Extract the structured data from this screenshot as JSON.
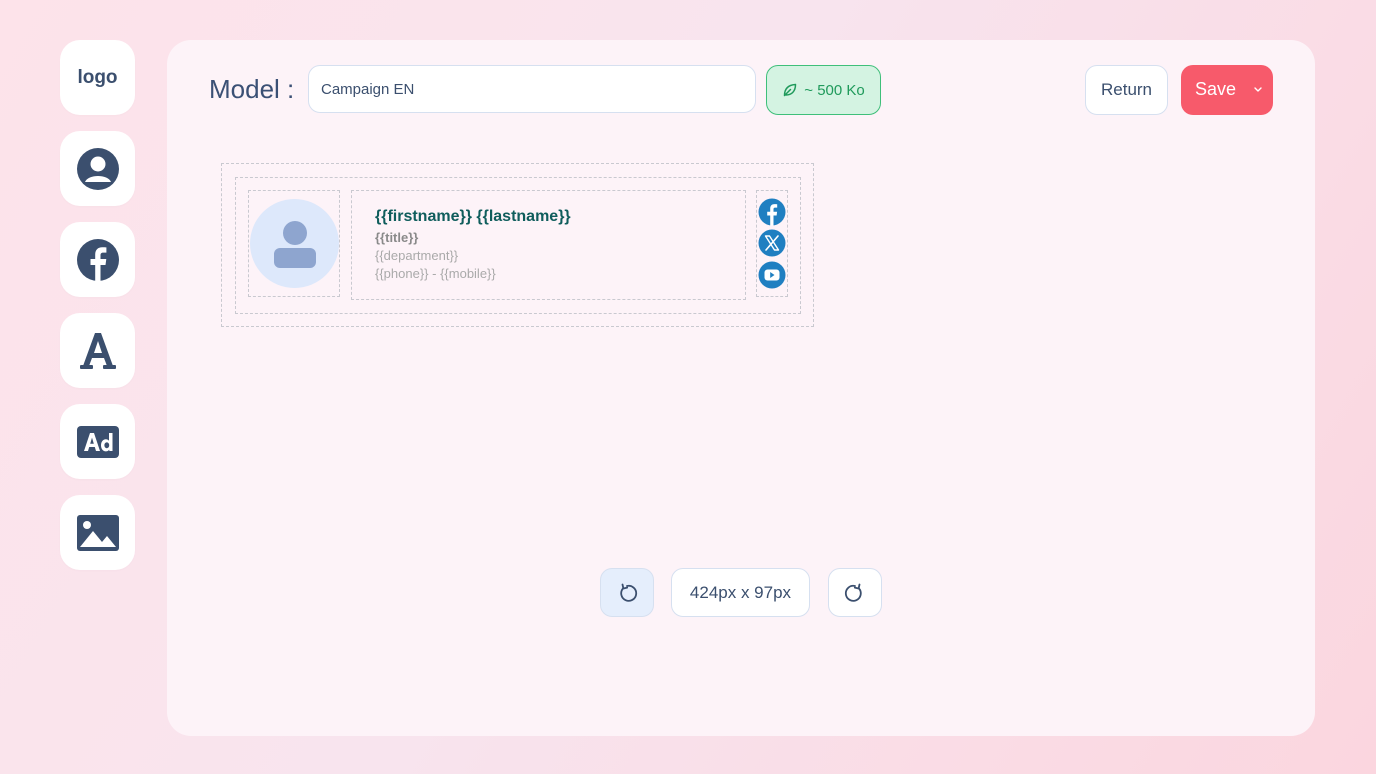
{
  "sidebar": {
    "logo_label": "logo",
    "items": [
      {
        "icon": "user-icon"
      },
      {
        "icon": "facebook-icon"
      },
      {
        "icon": "font-icon"
      },
      {
        "icon": "ad-icon"
      },
      {
        "icon": "image-icon"
      }
    ]
  },
  "header": {
    "model_label": "Model :",
    "model_value": "Campaign EN",
    "weight_label": "~ 500 Ko",
    "return_label": "Return",
    "save_label": "Save"
  },
  "signature": {
    "name": "{{firstname}} {{lastname}}",
    "title": "{{title}}",
    "department": "{{department}}",
    "phone": "{{phone}} - {{mobile}}",
    "socials": [
      "facebook-icon",
      "x-icon",
      "youtube-icon"
    ]
  },
  "canvas_controls": {
    "size_label": "424px x 97px"
  },
  "colors": {
    "accent": "#f75a6b",
    "primary": "#3b4f6e",
    "success": "#1f9a5b",
    "social_blue": "#1f7fc1",
    "name_teal": "#0f5d5c"
  }
}
